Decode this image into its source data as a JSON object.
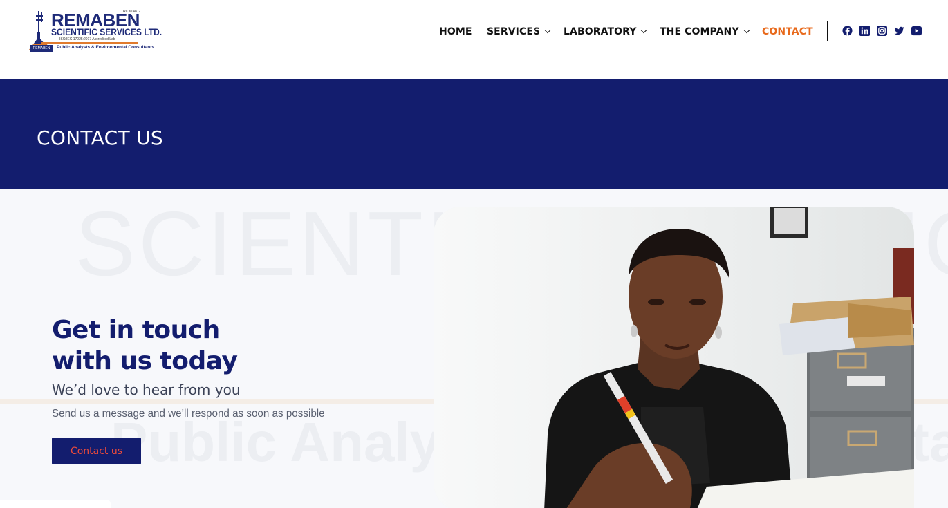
{
  "header": {
    "logo": {
      "title": "REMABEN",
      "subtitle": "SCIENTIFIC SERVICES LTD.",
      "iso": "ISO/IEC 17025:2017 Accredited Lab",
      "reg": "RC 614812",
      "tagline": "Public Analysts & Environmental Consultants",
      "badge": "REMABEN"
    },
    "nav": [
      {
        "label": "HOME",
        "dropdown": false,
        "active": false
      },
      {
        "label": "SERVICES",
        "dropdown": true,
        "active": false
      },
      {
        "label": "LABORATORY",
        "dropdown": true,
        "active": false
      },
      {
        "label": "THE COMPANY",
        "dropdown": true,
        "active": false
      },
      {
        "label": "CONTACT",
        "dropdown": false,
        "active": true
      }
    ],
    "social": [
      "facebook-icon",
      "linkedin-icon",
      "instagram-icon",
      "twitter-icon",
      "youtube-icon"
    ]
  },
  "banner": {
    "title": "CONTACT US"
  },
  "main": {
    "watermark_top": "SCIENTIFIC SERVICES",
    "watermark_bottom": "Public Analysts & Environmental",
    "heading_line1": "Get in touch",
    "heading_line2": "with us today",
    "subheading": "We’d love to hear from you",
    "description": "Send us a message and we’ll respond as soon as possible",
    "cta_label": "Contact us"
  },
  "colors": {
    "brand_navy": "#131d6e",
    "accent_orange": "#e86a1c",
    "cta_text": "#ee4b3a"
  }
}
